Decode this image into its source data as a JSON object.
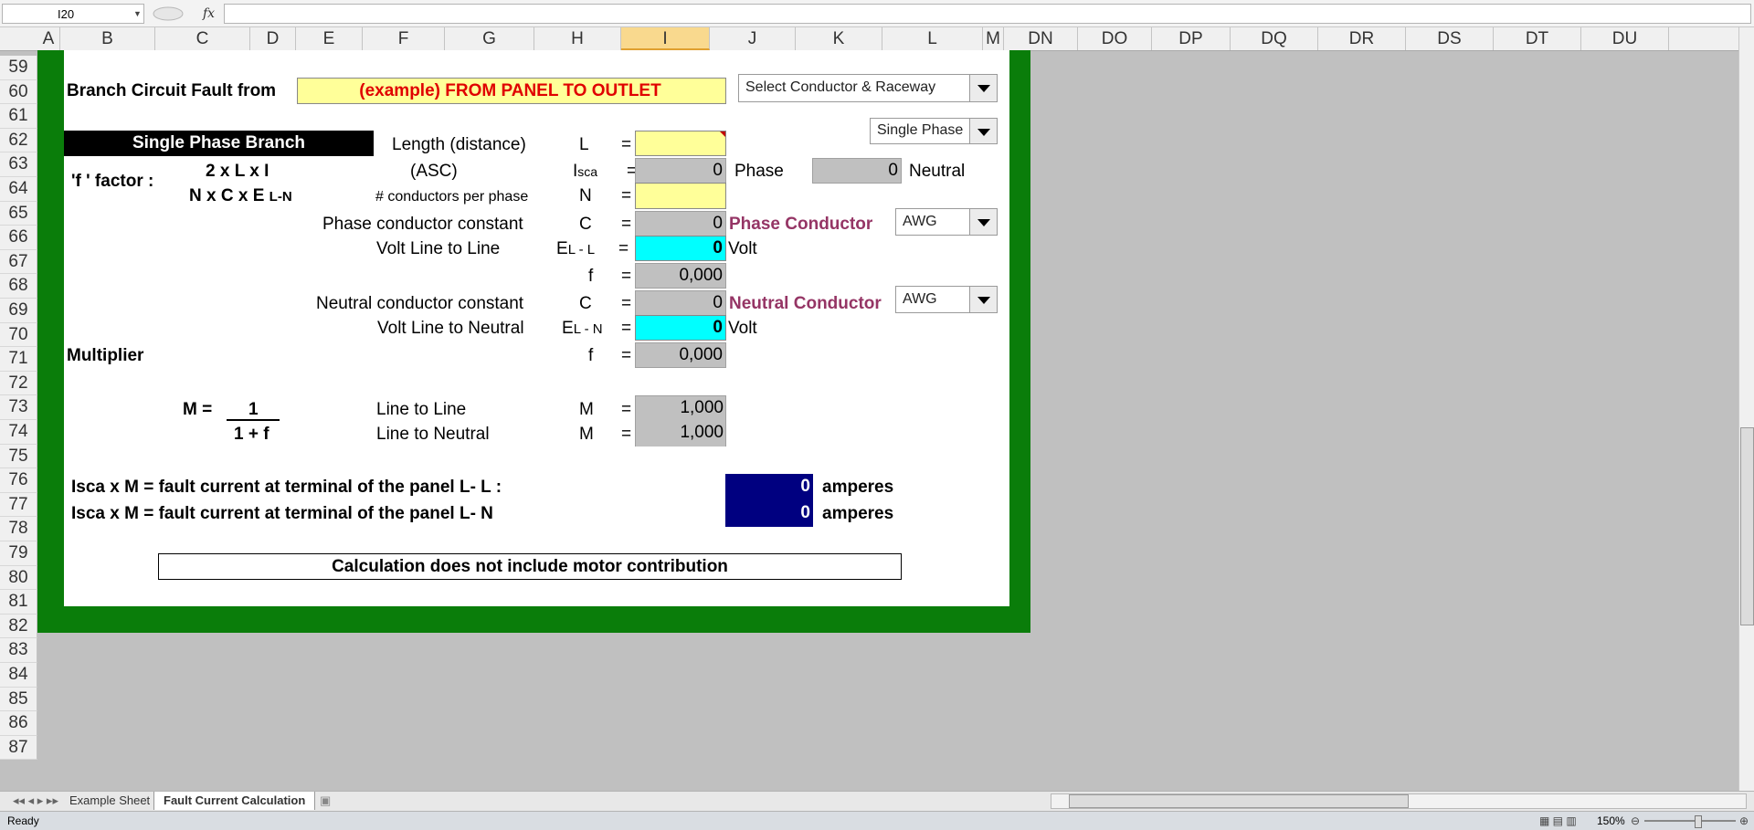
{
  "formula_bar": {
    "name_box": "I20",
    "fx": "fx",
    "formula": ""
  },
  "columns": [
    "A",
    "B",
    "C",
    "D",
    "E",
    "F",
    "G",
    "H",
    "I",
    "J",
    "K",
    "L",
    "M",
    "DN",
    "DO",
    "DP",
    "DQ",
    "DR",
    "DS",
    "DT",
    "DU"
  ],
  "selected_column": "I",
  "rows": [
    "59",
    "60",
    "61",
    "62",
    "63",
    "64",
    "65",
    "66",
    "67",
    "68",
    "69",
    "70",
    "71",
    "72",
    "73",
    "74",
    "75",
    "76",
    "77",
    "78",
    "79",
    "80",
    "81",
    "82",
    "83",
    "84",
    "85",
    "86",
    "87"
  ],
  "sheet": {
    "branch_circuit_label": "Branch Circuit Fault from",
    "branch_circuit_value": "(example) FROM PANEL TO OUTLET",
    "conductor_select": "Select Conductor & Raceway",
    "phase_select": "Single Phase",
    "single_phase_branch": "Single Phase Branch",
    "f_factor": "'f ' factor :",
    "formula_numerator": "2 x L x I",
    "formula_denominator": "N x C x E",
    "formula_denominator_sub": "L-N",
    "length_label": "Length (distance)",
    "asc_label": "(ASC)",
    "conductors_label": "# conductors per phase",
    "phase_const_label": "Phase conductor constant",
    "volt_ll_label": "Volt Line to Line",
    "neutral_const_label": "Neutral conductor constant",
    "volt_ln_label": "Volt Line to Neutral",
    "multiplier_label": "Multiplier",
    "sym_L": "L",
    "sym_I": "I",
    "sym_I_sub": "sca",
    "sym_N": "N",
    "sym_C": "C",
    "sym_E": "E",
    "sym_E_ll_sub": "L - L",
    "sym_E_ln_sub": "L - N",
    "sym_f": "f",
    "sym_M": "M",
    "eq": "=",
    "isca_value": "0",
    "isca_phase_label": "Phase",
    "isca_neutral_value": "0",
    "isca_neutral_label": "Neutral",
    "phase_const_value": "0",
    "phase_conductor_label": "Phase Conductor",
    "phase_awg": "AWG",
    "volt_ll_value": "0",
    "volt_unit": "Volt",
    "f1_value": "0,000",
    "neutral_const_value": "0",
    "neutral_conductor_label": "Neutral Conductor",
    "neutral_awg": "AWG",
    "volt_ln_value": "0",
    "f2_value": "0,000",
    "m_formula_lhs": "M =",
    "m_formula_num": "1",
    "m_formula_den": "1 + f",
    "line_to_line": "Line to Line",
    "line_to_neutral": "Line to Neutral",
    "m_ll_value": "1,000",
    "m_ln_value": "1,000",
    "fault_ll_label": "Isca  x  M  =  fault current at terminal of the panel L- L :",
    "fault_ln_label": "Isca  x  M  =  fault current at terminal of the panel L- N",
    "fault_ll_value": "0",
    "fault_ln_value": "0",
    "amperes": "amperes",
    "note": "Calculation does not include motor contribution"
  },
  "tabs": {
    "sheet1": "Example Sheet",
    "sheet2": "Fault Current Calculation"
  },
  "status": {
    "ready": "Ready",
    "zoom": "150%"
  }
}
